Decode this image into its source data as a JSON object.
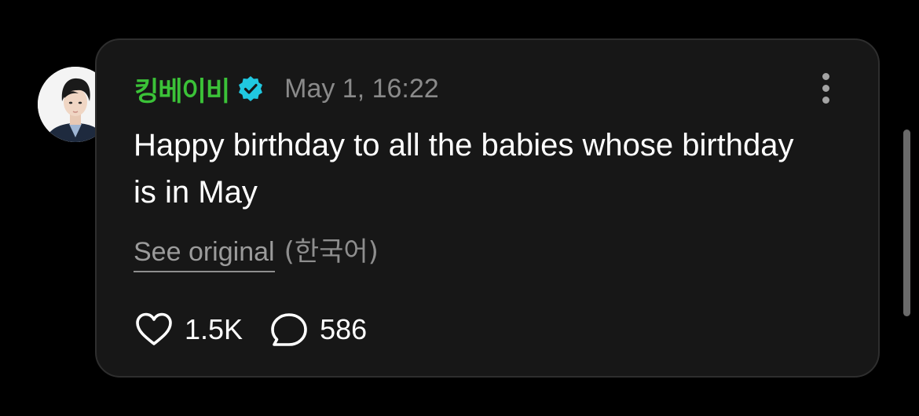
{
  "post": {
    "author": {
      "name": "킹베이비",
      "verified": true,
      "verified_icon": "verified-badge-icon",
      "name_color": "#3bc238",
      "badge_color": "#20c8e0"
    },
    "timestamp": "May 1, 16:22",
    "text": "Happy birthday to all the babies whose birthday is in May",
    "translation": {
      "see_original_label": "See original",
      "language_label": "(한국어)"
    },
    "actions": {
      "like": {
        "icon": "heart-icon",
        "count": "1.5K"
      },
      "comment": {
        "icon": "comment-bubble-icon",
        "count": "586"
      }
    },
    "more_icon": "more-vertical-icon"
  },
  "colors": {
    "background": "#000000",
    "card": "#171717",
    "card_border": "#2e2e2e",
    "text": "#ffffff",
    "muted": "#8e8e8e"
  }
}
